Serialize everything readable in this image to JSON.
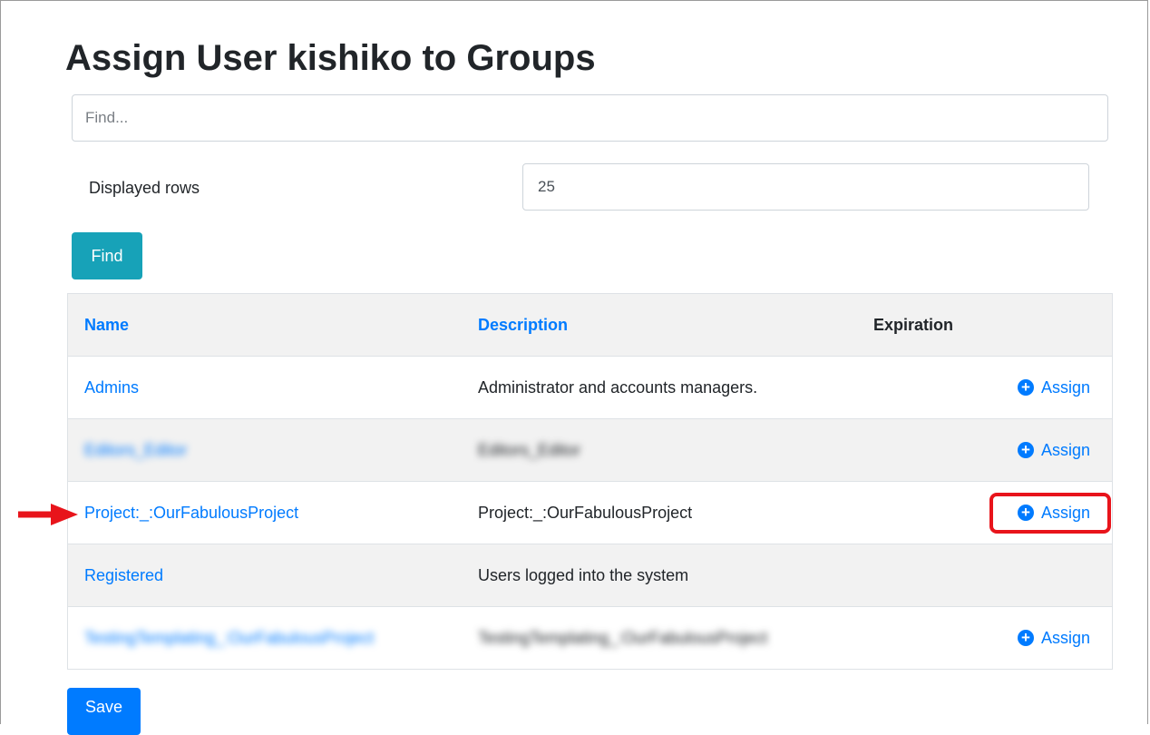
{
  "page": {
    "title": "Assign User kishiko to Groups"
  },
  "search": {
    "placeholder": "Find...",
    "value": ""
  },
  "displayed_rows": {
    "label": "Displayed rows",
    "value": "25"
  },
  "buttons": {
    "find_label": "Find",
    "save_label": "Save"
  },
  "table": {
    "headers": {
      "name": "Name",
      "description": "Description",
      "expiration": "Expiration"
    },
    "rows": [
      {
        "name": "Admins",
        "description": "Administrator and accounts managers.",
        "action": "Assign",
        "blurred": false
      },
      {
        "name": "Editors_Editor",
        "description": "Editors_Editor",
        "action": "Assign",
        "blurred": true
      },
      {
        "name": "Project:_:OurFabulousProject",
        "description": "Project:_:OurFabulousProject",
        "action": "Assign",
        "blurred": false
      },
      {
        "name": "Registered",
        "description": "Users logged into the system",
        "action": "",
        "blurred": false
      },
      {
        "name": "TestingTemplating_:OurFabulousProject",
        "description": "TestingTemplating_:OurFabulousProject",
        "action": "Assign",
        "blurred": true
      }
    ]
  },
  "icons": {
    "assign": "plus-circle-icon",
    "pointer": "red-arrow-icon"
  },
  "colors": {
    "link": "#007bff",
    "find_button": "#17a2b8",
    "save_button": "#007bff",
    "highlight": "#e8141b",
    "stripe": "#f2f2f2"
  }
}
